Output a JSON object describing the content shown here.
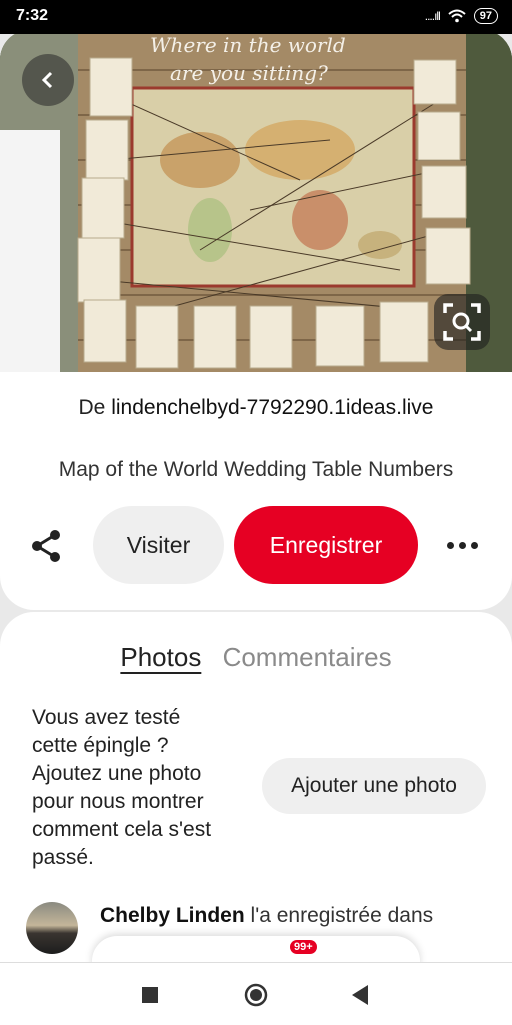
{
  "status_bar": {
    "time": "7:32",
    "signal": "....ıll",
    "battery": "97"
  },
  "hero": {
    "icons": [
      "back-icon",
      "visual-search-icon"
    ]
  },
  "pin": {
    "source_prefix": "De",
    "source_domain": "lindenchelbyd-7792290.1ideas.live",
    "title": "Map of the World Wedding Table Numbers"
  },
  "actions": {
    "visit_label": "Visiter",
    "save_label": "Enregistrer",
    "share_icon": "share-icon",
    "more_icon": "more-icon"
  },
  "tabs": {
    "photos": "Photos",
    "comments": "Commentaires"
  },
  "try_prompt": {
    "lines": [
      "Vous avez testé",
      "cette épingle ?",
      "Ajoutez une photo",
      "pour nous montrer",
      "comment cela s'est",
      "passé."
    ],
    "button": "Ajouter une photo"
  },
  "activity": {
    "user": "Chelby Linden",
    "text": "l'a enregistrée dans"
  },
  "bottom_tabbar": {
    "badge": "99+"
  },
  "colors": {
    "accent": "#e60023",
    "button_bg": "#efefef"
  }
}
